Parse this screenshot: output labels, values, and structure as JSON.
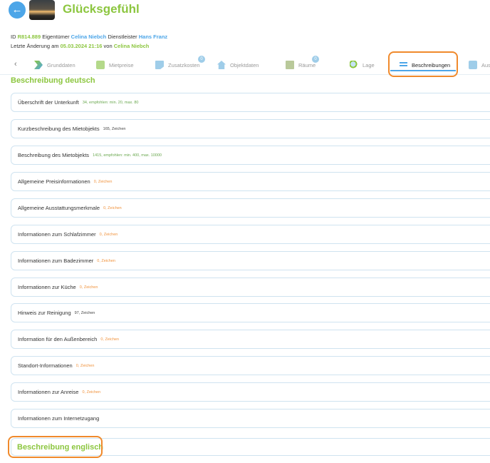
{
  "header": {
    "title": "Glücksgefühl",
    "back_icon": "arrow-left-icon"
  },
  "meta": {
    "id_label": "ID",
    "id_value": "R814.889",
    "owner_label": "Eigentümer",
    "owner_value": "Celina Niebch",
    "provider_label": "Dienstleister",
    "provider_value": "Hans Franz",
    "changed_label": "Letzte Änderung am",
    "changed_value": "05.03.2024 21:16",
    "by_label": "von",
    "by_value": "Celina Niebch"
  },
  "tabs": {
    "prev_icon": "‹",
    "items": [
      {
        "label": "Grunddaten",
        "icon": "grunddaten-icon"
      },
      {
        "label": "Mietpreise",
        "icon": "mietpreise-icon"
      },
      {
        "label": "Zusatzkosten",
        "icon": "zusatzkosten-icon",
        "badge": "0"
      },
      {
        "label": "Objektdaten",
        "icon": "house-icon"
      },
      {
        "label": "Räume",
        "icon": "rooms-icon",
        "badge": "0"
      },
      {
        "label": "Lage",
        "icon": "location-icon"
      },
      {
        "label": "Beschreibungen",
        "icon": "text-lines-icon",
        "active": true
      },
      {
        "label": "Aus",
        "icon": "ausstattung-icon"
      }
    ]
  },
  "section_de": {
    "title": "Beschreibung deutsch",
    "rows": [
      {
        "label": "Überschrift der Unterkunft",
        "hint": "34, empfohlen: min. 20, max. 80",
        "hint_color": "green"
      },
      {
        "label": "Kurzbeschreibung des Mietobjekts",
        "hint": "165, Zeichen",
        "hint_color": "gray"
      },
      {
        "label": "Beschreibung des Mietobjekts",
        "hint": "1415, empfohlen: min. 400, max. 10000",
        "hint_color": "green"
      },
      {
        "label": "Allgemeine Preisinformationen",
        "hint": "0, Zeichen",
        "hint_color": "orange"
      },
      {
        "label": "Allgemeine Ausstattungsmerkmale",
        "hint": "0, Zeichen",
        "hint_color": "orange"
      },
      {
        "label": "Informationen zum Schlafzimmer",
        "hint": "0, Zeichen",
        "hint_color": "orange"
      },
      {
        "label": "Informationen zum Badezimmer",
        "hint": "0, Zeichen",
        "hint_color": "orange"
      },
      {
        "label": "Informationen zur Küche",
        "hint": "0, Zeichen",
        "hint_color": "orange"
      },
      {
        "label": "Hinweis zur Reinigung",
        "hint": "97, Zeichen",
        "hint_color": "gray"
      },
      {
        "label": "Information für den Außenbereich",
        "hint": "0, Zeichen",
        "hint_color": "orange"
      },
      {
        "label": "Standort-Informationen",
        "hint": "0, Zeichen",
        "hint_color": "orange"
      },
      {
        "label": "Informationen zur Anreise",
        "hint": "0, Zeichen",
        "hint_color": "orange"
      },
      {
        "label": "Informationen zum Internetzugang",
        "hint": "",
        "hint_color": "gray"
      }
    ]
  },
  "section_en": {
    "title": "Beschreibung englisch"
  },
  "colors": {
    "accent_green": "#8cc63f",
    "accent_blue": "#4da6e8",
    "highlight_orange": "#f08a2c",
    "hint_orange": "#f0923c"
  }
}
